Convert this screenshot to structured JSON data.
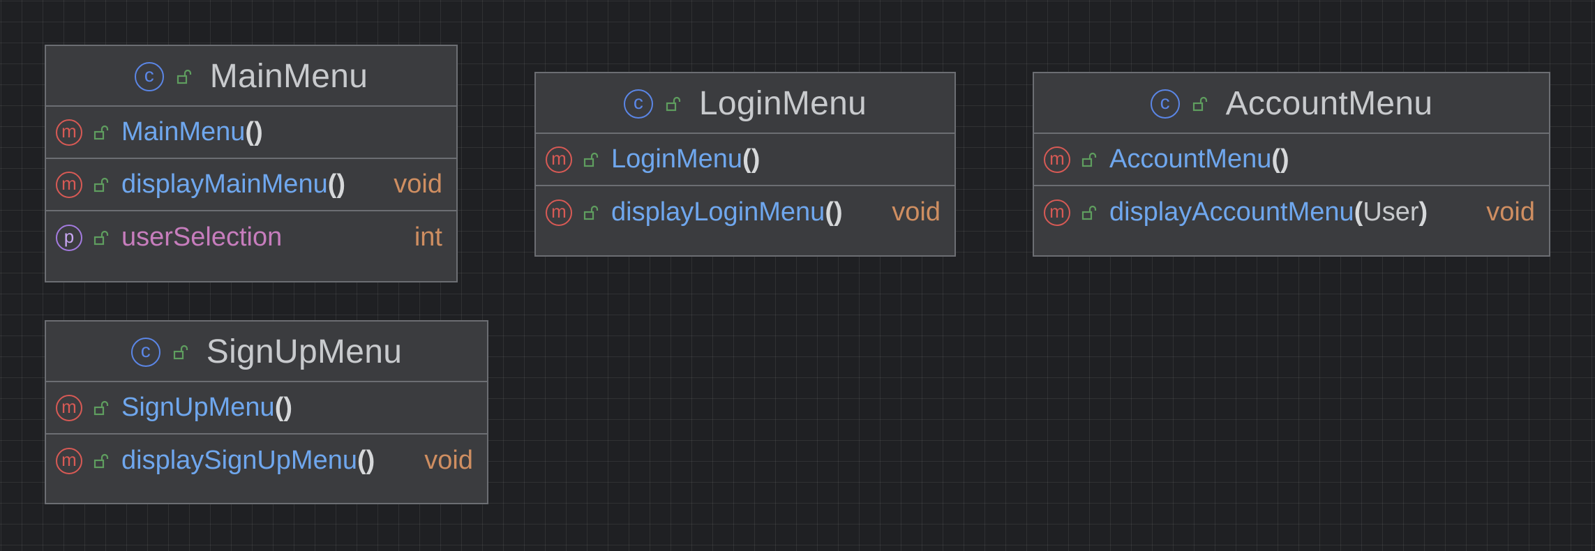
{
  "classes": [
    {
      "name": "MainMenu",
      "kind_icon": "class-icon",
      "kind_letter": "c",
      "members": [
        {
          "kind": "method",
          "letter": "m",
          "name": "MainMenu",
          "open": "(",
          "param": "",
          "close": ")",
          "type": ""
        },
        {
          "kind": "method",
          "letter": "m",
          "name": "displayMainMenu",
          "open": "(",
          "param": "",
          "close": ")",
          "type": "void"
        },
        {
          "kind": "property",
          "letter": "p",
          "name": "userSelection",
          "type": "int"
        }
      ]
    },
    {
      "name": "LoginMenu",
      "kind_icon": "class-icon",
      "kind_letter": "c",
      "members": [
        {
          "kind": "method",
          "letter": "m",
          "name": "LoginMenu",
          "open": "(",
          "param": "",
          "close": ")",
          "type": ""
        },
        {
          "kind": "method",
          "letter": "m",
          "name": "displayLoginMenu",
          "open": "(",
          "param": "",
          "close": ")",
          "type": "void"
        }
      ]
    },
    {
      "name": "AccountMenu",
      "kind_icon": "class-icon",
      "kind_letter": "c",
      "members": [
        {
          "kind": "method",
          "letter": "m",
          "name": "AccountMenu",
          "open": "(",
          "param": "",
          "close": ")",
          "type": ""
        },
        {
          "kind": "method",
          "letter": "m",
          "name": "displayAccountMenu",
          "open": "(",
          "param": "User",
          "close": ")",
          "type": "void"
        }
      ]
    },
    {
      "name": "SignUpMenu",
      "kind_icon": "class-icon",
      "kind_letter": "c",
      "members": [
        {
          "kind": "method",
          "letter": "m",
          "name": "SignUpMenu",
          "open": "(",
          "param": "",
          "close": ")",
          "type": ""
        },
        {
          "kind": "method",
          "letter": "m",
          "name": "displaySignUpMenu",
          "open": "(",
          "param": "",
          "close": ")",
          "type": "void"
        }
      ]
    }
  ],
  "icons": {
    "visibility": "unlocked-public-icon",
    "method": "method-icon",
    "property": "property-icon"
  },
  "colors": {
    "background": "#1f2023",
    "node_fill": "#3b3c3f",
    "node_border": "#6c6e73",
    "class_icon": "#5b86e6",
    "method_icon": "#d85a55",
    "property_icon": "#a47be0",
    "lock_icon": "#5f9e5f",
    "method_name": "#6fa7ee",
    "field_name": "#c77dbd",
    "return_type": "#cf8e61",
    "title_text": "#c8cacd"
  }
}
